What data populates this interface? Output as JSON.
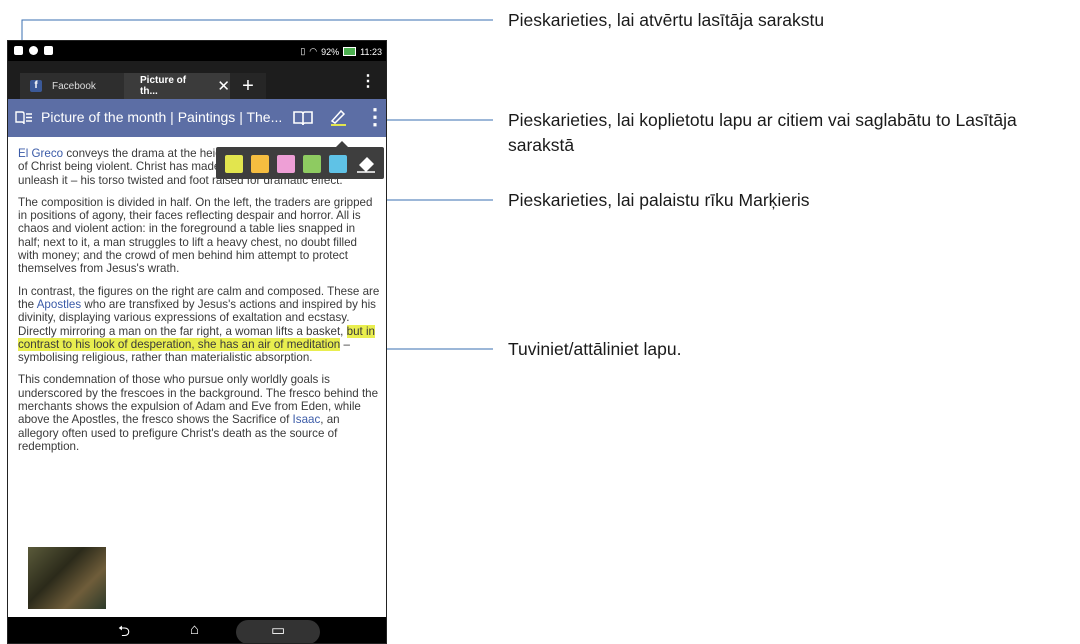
{
  "status_bar": {
    "battery_text": "92%",
    "time": "11:23"
  },
  "tabs": [
    {
      "label": "Facebook",
      "icon": "facebook-icon"
    },
    {
      "label": "Picture of th...",
      "close_glyph": "✕"
    }
  ],
  "new_tab_glyph": "+",
  "menu_glyph": "⋮",
  "address_bar": {
    "title": "Picture of the month | Paintings | The..."
  },
  "highlight_colors": [
    "#e2e54e",
    "#f5bd40",
    "#ee9fd6",
    "#8ecb61",
    "#5fc2e6"
  ],
  "article": {
    "p1": {
      "link": "El Greco",
      "text": " conveys the drama at the height of the story and the shock of Christ being violent. Christ has made a flail and is poised ready to unleash it – his torso twisted and foot raised for dramatic effect."
    },
    "p2": "The composition is divided in half. On the left, the traders are gripped in positions of agony, their faces reflecting despair and horror. All is chaos and violent action: in the foreground a table lies snapped in half; next to it, a man struggles to lift a heavy chest, no doubt filled with money; and the crowd of men behind him attempt to protect themselves from Jesus's wrath.",
    "p3": {
      "a": "In contrast, the figures on the right are calm and composed. These are the ",
      "link": "Apostles",
      "b": " who are transfixed by Jesus's actions and inspired by his divinity, displaying various expressions of exaltation and ecstasy. Directly mirroring a man on the far right, a woman lifts a basket, ",
      "highlight": "but in contrast to his look of desperation, she has an air of meditation",
      "c": " – symbolising religious, rather than materialistic absorption."
    },
    "p4": {
      "a": "This condemnation of those who pursue only worldly goals is underscored by the frescoes in the background. The fresco behind the merchants shows the expulsion of Adam and Eve from Eden, while above the Apostles, the fresco shows the Sacrifice of ",
      "link": "Isaac",
      "b": ", an allegory often used to prefigure Christ's death as the source of redemption."
    }
  },
  "nav": {
    "back": "⮌",
    "home": "⌂",
    "recents": "▭"
  },
  "callouts": {
    "reading_list": "Pieskarieties, lai atvērtu lasītāja sarakstu",
    "share": "Pieskarieties, lai koplietotu lapu ar citiem vai saglabātu to Lasītāja sarakstā",
    "marker": "Pieskarieties, lai palaistu rīku Marķieris",
    "zoom": "Tuviniet/attāliniet lapu."
  }
}
